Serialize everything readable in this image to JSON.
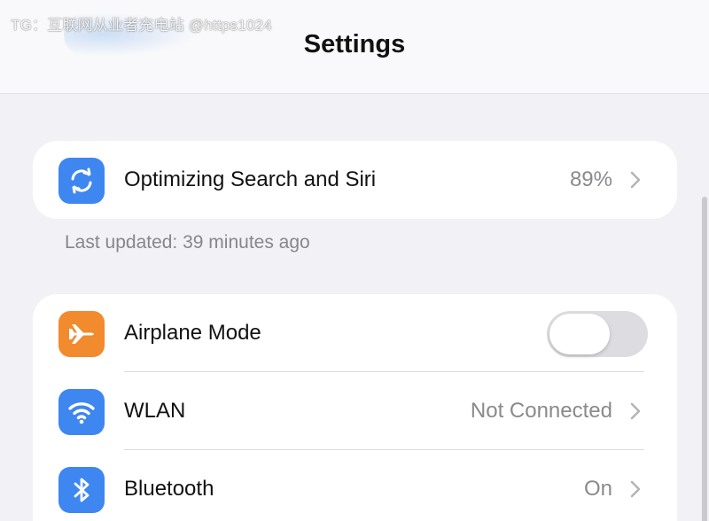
{
  "watermark": "TG：互联网从业者充电站 @https1024",
  "header": {
    "title": "Settings"
  },
  "optimizing": {
    "label": "Optimizing Search and Siri",
    "value": "89%",
    "icon": "sync-icon",
    "footnote": "Last updated: 39 minutes ago"
  },
  "network": {
    "airplane": {
      "label": "Airplane Mode",
      "icon": "airplane-icon",
      "toggle_on": false
    },
    "wlan": {
      "label": "WLAN",
      "value": "Not Connected",
      "icon": "wifi-icon"
    },
    "bluetooth": {
      "label": "Bluetooth",
      "value": "On",
      "icon": "bluetooth-icon"
    }
  },
  "colors": {
    "background": "#f2f2f6",
    "icon_blue": "#3e86f0",
    "icon_orange": "#f28a2e",
    "secondary_text": "#8a8a8e",
    "toggle_off": "#dddde1"
  }
}
